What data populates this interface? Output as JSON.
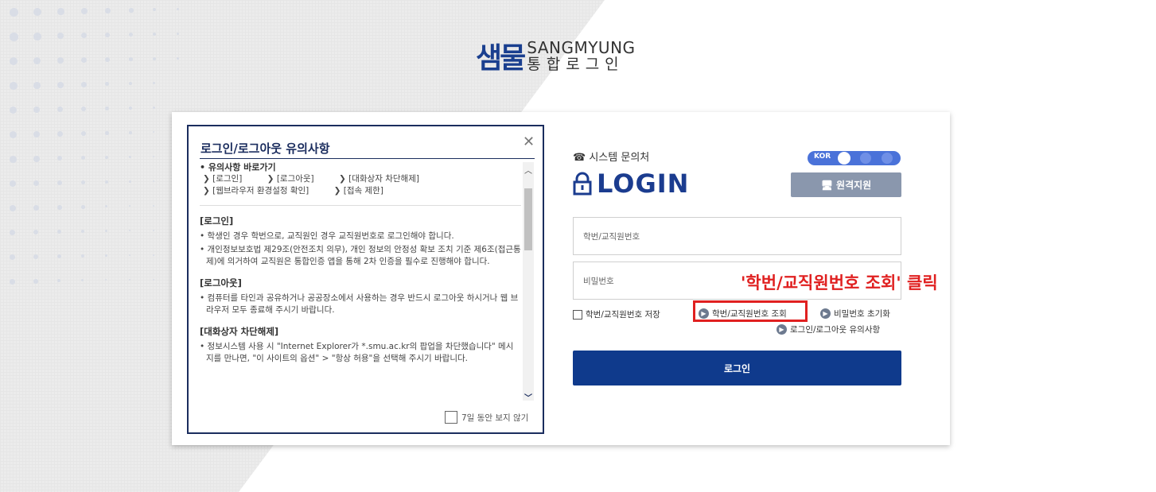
{
  "brand": {
    "mark": "샘물",
    "en": "SANGMYUNG",
    "ko": "통합로그인"
  },
  "notice": {
    "title": "로그인/로그아웃 유의사항",
    "close_icon": "close-icon",
    "quick_heading": "• 유의사항 바로가기",
    "quick_links": [
      "[로그인]",
      "[로그아웃]",
      "[대화상자 차단해제]",
      "[웹브라우저 환경설정 확인]",
      "[접속 제한]"
    ],
    "sections": [
      {
        "title": "[로그인]",
        "lines": [
          "• 학생인 경우 학번으로, 교직원인 경우 교직원번호로 로그인해야 합니다.",
          "• 개인정보보호법 제29조(안전조치 의무), 개인 정보의 안정성 확보 조치 기준 제6조(접근통제)에 의거하여 교직원은 통합인증 앱을 통해 2차 인증을 필수로 진행해야 합니다."
        ]
      },
      {
        "title": "[로그아웃]",
        "lines": [
          "• 컴퓨터를 타인과 공유하거나 공공장소에서 사용하는 경우 반드시 로그아웃 하시거나 웹 브라우저 모두 종료해 주시기 바랍니다."
        ]
      },
      {
        "title": "[대화상자 차단해제]",
        "lines": [
          "• 정보시스템 사용 시 \"Internet Explorer가 *.smu.ac.kr의 팝업을 차단했습니다\" 메시지를 만나면, \"이 사이트의 옵션\" > \"항상 허용\"을 선택해 주시기 바랍니다."
        ]
      }
    ],
    "dont_show": "7일 동안 보지 않기"
  },
  "login": {
    "inquiry": "시스템 문의처",
    "lang": "KOR",
    "heading": "LOGIN",
    "remote_support": "원격지원",
    "id_placeholder": "학번/교직원번호",
    "pw_placeholder": "비밀번호",
    "save_id": "학번/교직원번호 저장",
    "lookup": "학번/교직원번호 조회",
    "reset_pw": "비밀번호 초기화",
    "notice_link": "로그인/로그아웃 유의사항",
    "login_button": "로그인"
  },
  "annotation": "'학번/교직원번호 조회' 클릭",
  "colors": {
    "primary": "#0f3a8c",
    "heading": "#1b3c8f",
    "highlight": "#e02020",
    "toggle": "#4a72d9"
  }
}
